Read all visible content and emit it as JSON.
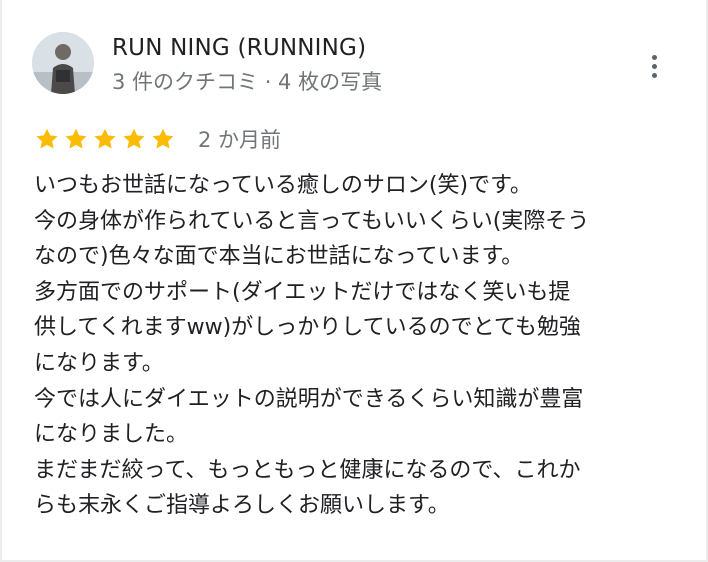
{
  "reviewer": {
    "name": "RUN NING (RUNNING)",
    "meta": "3 件のクチコミ · 4 枚の写真"
  },
  "review": {
    "rating": 5,
    "rating_max": 5,
    "date": "2 か月前",
    "lines": [
      "いつもお世話になっている癒しのサロン(笑)です。",
      "今の身体が作られていると言ってもいいくらい(実際そう",
      "なので)色々な面で本当にお世話になっています。",
      "多方面でのサポート(ダイエットだけではなく笑いも提",
      "供してくれますww)がしっかりしているのでとても勉強",
      "になります。",
      "今では人にダイエットの説明ができるくらい知識が豊富",
      "になりました。",
      "まだまだ絞って、もっともっと健康になるので、これか",
      "らも末永くご指導よろしくお願いします。"
    ]
  },
  "icons": {
    "star": "star-icon",
    "more": "more-vert-icon"
  },
  "colors": {
    "star": "#fbbc04",
    "name": "#202124",
    "secondary": "#70757a",
    "icon": "#5f6368"
  }
}
